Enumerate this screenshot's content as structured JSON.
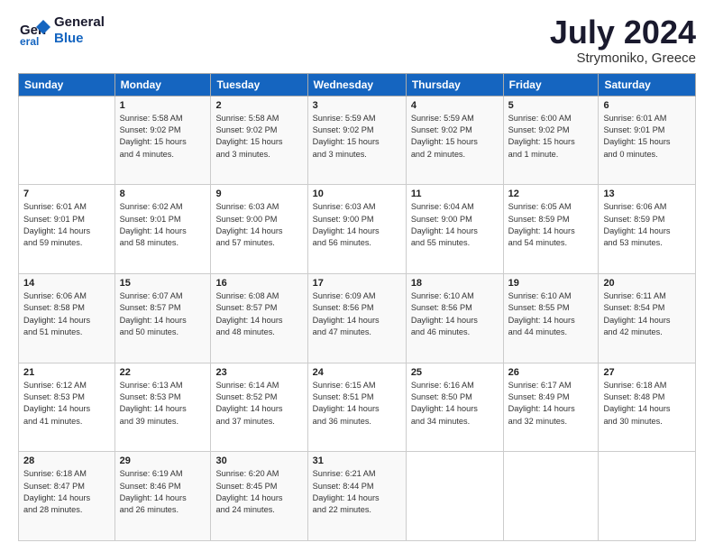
{
  "header": {
    "logo_line1": "General",
    "logo_line2": "Blue",
    "month_year": "July 2024",
    "location": "Strymoniko, Greece"
  },
  "days_of_week": [
    "Sunday",
    "Monday",
    "Tuesday",
    "Wednesday",
    "Thursday",
    "Friday",
    "Saturday"
  ],
  "weeks": [
    [
      {
        "day": "",
        "info": ""
      },
      {
        "day": "1",
        "info": "Sunrise: 5:58 AM\nSunset: 9:02 PM\nDaylight: 15 hours\nand 4 minutes."
      },
      {
        "day": "2",
        "info": "Sunrise: 5:58 AM\nSunset: 9:02 PM\nDaylight: 15 hours\nand 3 minutes."
      },
      {
        "day": "3",
        "info": "Sunrise: 5:59 AM\nSunset: 9:02 PM\nDaylight: 15 hours\nand 3 minutes."
      },
      {
        "day": "4",
        "info": "Sunrise: 5:59 AM\nSunset: 9:02 PM\nDaylight: 15 hours\nand 2 minutes."
      },
      {
        "day": "5",
        "info": "Sunrise: 6:00 AM\nSunset: 9:02 PM\nDaylight: 15 hours\nand 1 minute."
      },
      {
        "day": "6",
        "info": "Sunrise: 6:01 AM\nSunset: 9:01 PM\nDaylight: 15 hours\nand 0 minutes."
      }
    ],
    [
      {
        "day": "7",
        "info": "Sunrise: 6:01 AM\nSunset: 9:01 PM\nDaylight: 14 hours\nand 59 minutes."
      },
      {
        "day": "8",
        "info": "Sunrise: 6:02 AM\nSunset: 9:01 PM\nDaylight: 14 hours\nand 58 minutes."
      },
      {
        "day": "9",
        "info": "Sunrise: 6:03 AM\nSunset: 9:00 PM\nDaylight: 14 hours\nand 57 minutes."
      },
      {
        "day": "10",
        "info": "Sunrise: 6:03 AM\nSunset: 9:00 PM\nDaylight: 14 hours\nand 56 minutes."
      },
      {
        "day": "11",
        "info": "Sunrise: 6:04 AM\nSunset: 9:00 PM\nDaylight: 14 hours\nand 55 minutes."
      },
      {
        "day": "12",
        "info": "Sunrise: 6:05 AM\nSunset: 8:59 PM\nDaylight: 14 hours\nand 54 minutes."
      },
      {
        "day": "13",
        "info": "Sunrise: 6:06 AM\nSunset: 8:59 PM\nDaylight: 14 hours\nand 53 minutes."
      }
    ],
    [
      {
        "day": "14",
        "info": "Sunrise: 6:06 AM\nSunset: 8:58 PM\nDaylight: 14 hours\nand 51 minutes."
      },
      {
        "day": "15",
        "info": "Sunrise: 6:07 AM\nSunset: 8:57 PM\nDaylight: 14 hours\nand 50 minutes."
      },
      {
        "day": "16",
        "info": "Sunrise: 6:08 AM\nSunset: 8:57 PM\nDaylight: 14 hours\nand 48 minutes."
      },
      {
        "day": "17",
        "info": "Sunrise: 6:09 AM\nSunset: 8:56 PM\nDaylight: 14 hours\nand 47 minutes."
      },
      {
        "day": "18",
        "info": "Sunrise: 6:10 AM\nSunset: 8:56 PM\nDaylight: 14 hours\nand 46 minutes."
      },
      {
        "day": "19",
        "info": "Sunrise: 6:10 AM\nSunset: 8:55 PM\nDaylight: 14 hours\nand 44 minutes."
      },
      {
        "day": "20",
        "info": "Sunrise: 6:11 AM\nSunset: 8:54 PM\nDaylight: 14 hours\nand 42 minutes."
      }
    ],
    [
      {
        "day": "21",
        "info": "Sunrise: 6:12 AM\nSunset: 8:53 PM\nDaylight: 14 hours\nand 41 minutes."
      },
      {
        "day": "22",
        "info": "Sunrise: 6:13 AM\nSunset: 8:53 PM\nDaylight: 14 hours\nand 39 minutes."
      },
      {
        "day": "23",
        "info": "Sunrise: 6:14 AM\nSunset: 8:52 PM\nDaylight: 14 hours\nand 37 minutes."
      },
      {
        "day": "24",
        "info": "Sunrise: 6:15 AM\nSunset: 8:51 PM\nDaylight: 14 hours\nand 36 minutes."
      },
      {
        "day": "25",
        "info": "Sunrise: 6:16 AM\nSunset: 8:50 PM\nDaylight: 14 hours\nand 34 minutes."
      },
      {
        "day": "26",
        "info": "Sunrise: 6:17 AM\nSunset: 8:49 PM\nDaylight: 14 hours\nand 32 minutes."
      },
      {
        "day": "27",
        "info": "Sunrise: 6:18 AM\nSunset: 8:48 PM\nDaylight: 14 hours\nand 30 minutes."
      }
    ],
    [
      {
        "day": "28",
        "info": "Sunrise: 6:18 AM\nSunset: 8:47 PM\nDaylight: 14 hours\nand 28 minutes."
      },
      {
        "day": "29",
        "info": "Sunrise: 6:19 AM\nSunset: 8:46 PM\nDaylight: 14 hours\nand 26 minutes."
      },
      {
        "day": "30",
        "info": "Sunrise: 6:20 AM\nSunset: 8:45 PM\nDaylight: 14 hours\nand 24 minutes."
      },
      {
        "day": "31",
        "info": "Sunrise: 6:21 AM\nSunset: 8:44 PM\nDaylight: 14 hours\nand 22 minutes."
      },
      {
        "day": "",
        "info": ""
      },
      {
        "day": "",
        "info": ""
      },
      {
        "day": "",
        "info": ""
      }
    ]
  ]
}
